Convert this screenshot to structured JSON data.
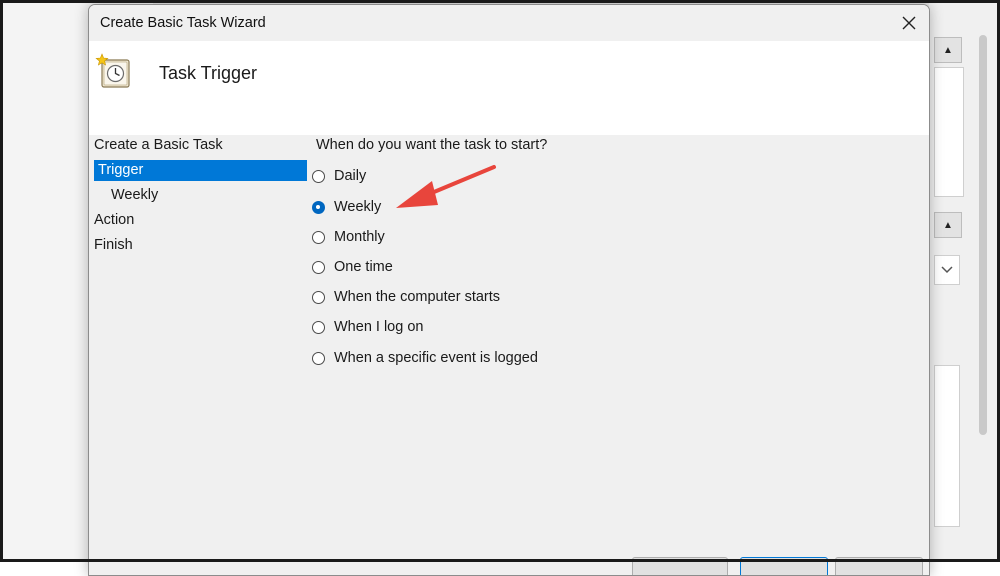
{
  "dialog": {
    "title": "Create Basic Task Wizard",
    "header_title": "Task Trigger",
    "question": "When do you want the task to start?"
  },
  "nav": {
    "items": [
      {
        "label": "Create a Basic Task",
        "selected": false
      },
      {
        "label": "Trigger",
        "selected": true
      },
      {
        "label": "Weekly",
        "selected": false
      },
      {
        "label": "Action",
        "selected": false
      },
      {
        "label": "Finish",
        "selected": false
      }
    ]
  },
  "options": [
    {
      "label": "Daily",
      "checked": false
    },
    {
      "label": "Weekly",
      "checked": true
    },
    {
      "label": "Monthly",
      "checked": false
    },
    {
      "label": "One time",
      "checked": false
    },
    {
      "label": "When the computer starts",
      "checked": false
    },
    {
      "label": "When I log on",
      "checked": false
    },
    {
      "label": "When a specific event is logged",
      "checked": false
    }
  ],
  "colors": {
    "selection": "#0078d7",
    "radio_checked": "#0067c0",
    "annotation_arrow": "#e8453c"
  },
  "icons": {
    "close": "close-icon",
    "header": "scheduled-task-clock-icon",
    "annotation": "red-arrow-annotation"
  }
}
